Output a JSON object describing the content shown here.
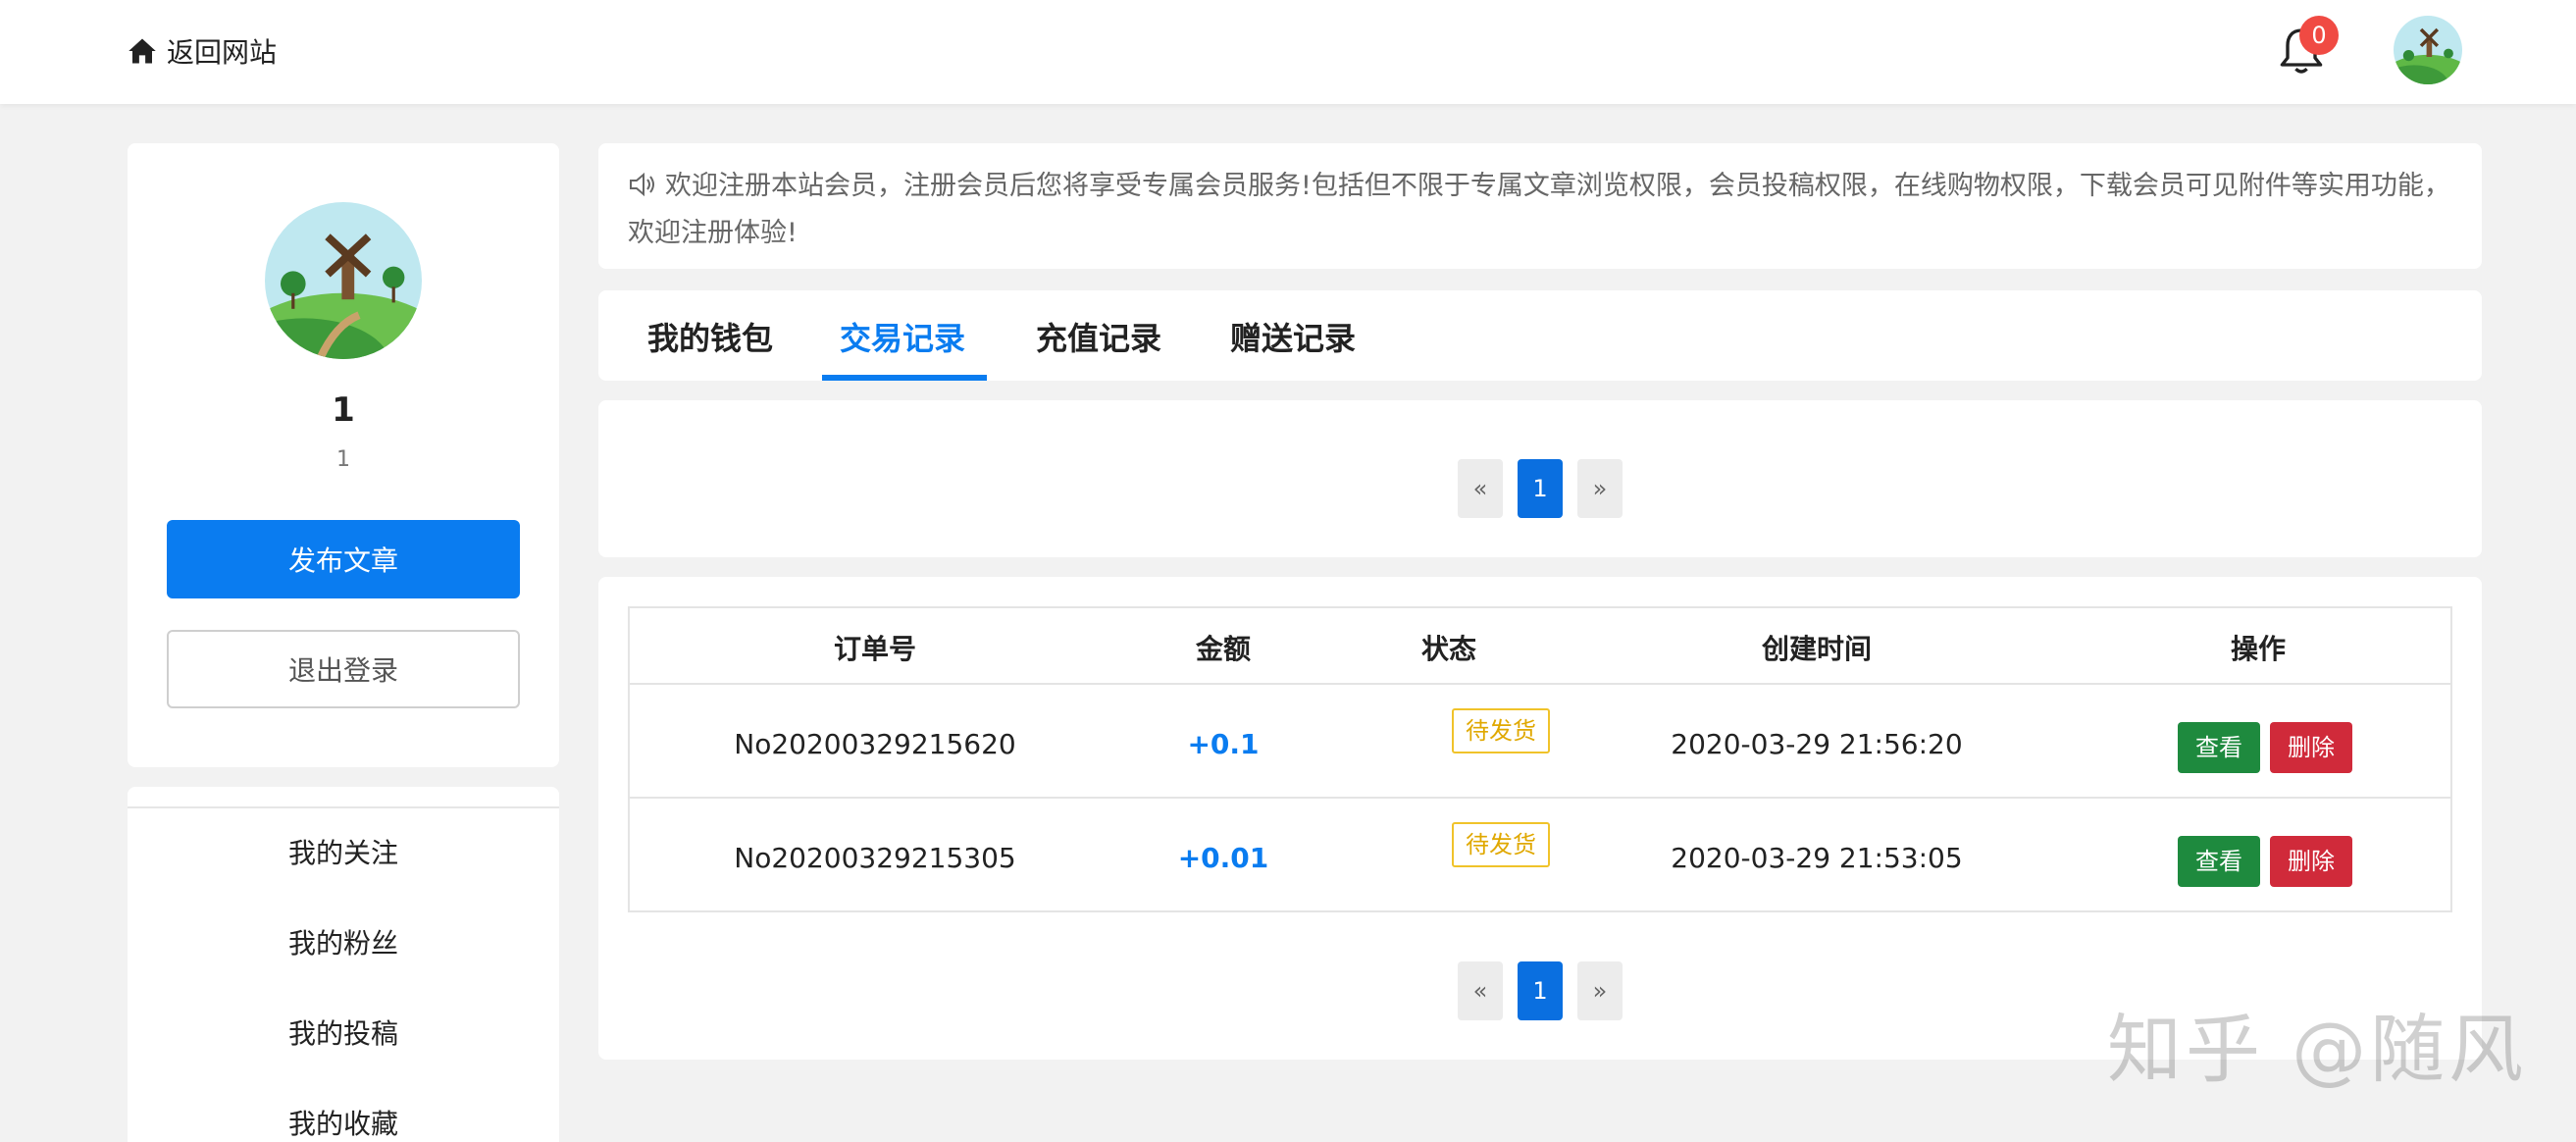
{
  "header": {
    "back_label": "返回网站",
    "notification_count": "0"
  },
  "profile": {
    "name": "1",
    "subtitle": "1",
    "publish_label": "发布文章",
    "logout_label": "退出登录"
  },
  "menu": {
    "items": [
      "我的关注",
      "我的粉丝",
      "我的投稿",
      "我的收藏"
    ]
  },
  "notice": {
    "text": "欢迎注册本站会员，注册会员后您将享受专属会员服务!包括但不限于专属文章浏览权限，会员投稿权限，在线购物权限，下载会员可见附件等实用功能，欢迎注册体验!"
  },
  "tabs": {
    "items": [
      "我的钱包",
      "交易记录",
      "充值记录",
      "赠送记录"
    ],
    "active": "交易记录"
  },
  "pagination": {
    "prev": "«",
    "current": "1",
    "next": "»"
  },
  "table": {
    "headers": [
      "订单号",
      "金额",
      "状态",
      "创建时间",
      "操作"
    ],
    "rows": [
      {
        "order": "No20200329215620",
        "amount": "+0.1",
        "status": "待发货",
        "time": "2020-03-29 21:56:20",
        "view": "查看",
        "delete": "删除"
      },
      {
        "order": "No20200329215305",
        "amount": "+0.01",
        "status": "待发货",
        "time": "2020-03-29 21:53:05",
        "view": "查看",
        "delete": "删除"
      }
    ]
  },
  "watermark": "知乎 @随风",
  "colors": {
    "accent": "#0a7cf0",
    "view_button": "#1e8a3e",
    "delete_button": "#d02a3a",
    "status_tag": "#f0c32a",
    "badge": "#f04a43"
  }
}
